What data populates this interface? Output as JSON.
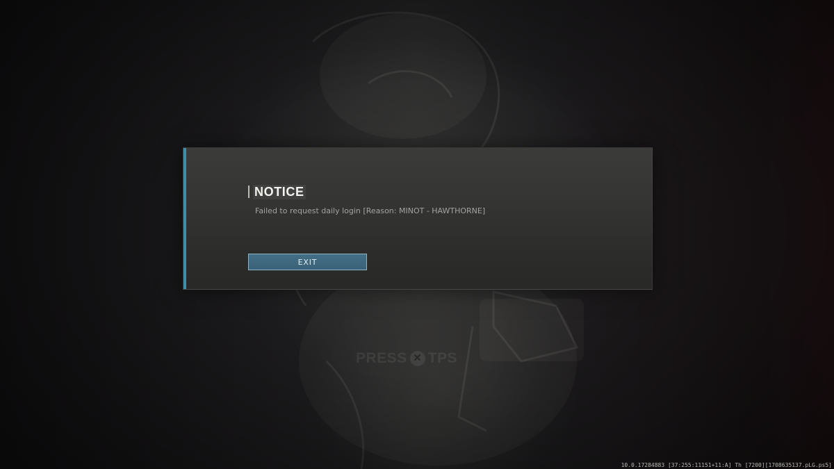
{
  "background": {
    "watermark_prompt": {
      "left_text": "PRESS",
      "button_glyph": "✕",
      "right_text": "TPS"
    }
  },
  "dialog": {
    "title": "NOTICE",
    "message": "Failed to request daily login [Reason: MINOT - HAWTHORNE]",
    "exit_label": "EXIT",
    "accent_color": "#3f8cab",
    "button_color": "#3f6a80"
  },
  "footer": {
    "build_info": "10.0.17284883 [37:255:11151+11:A] Th [7200][1708635137.pLG.ps5]"
  }
}
